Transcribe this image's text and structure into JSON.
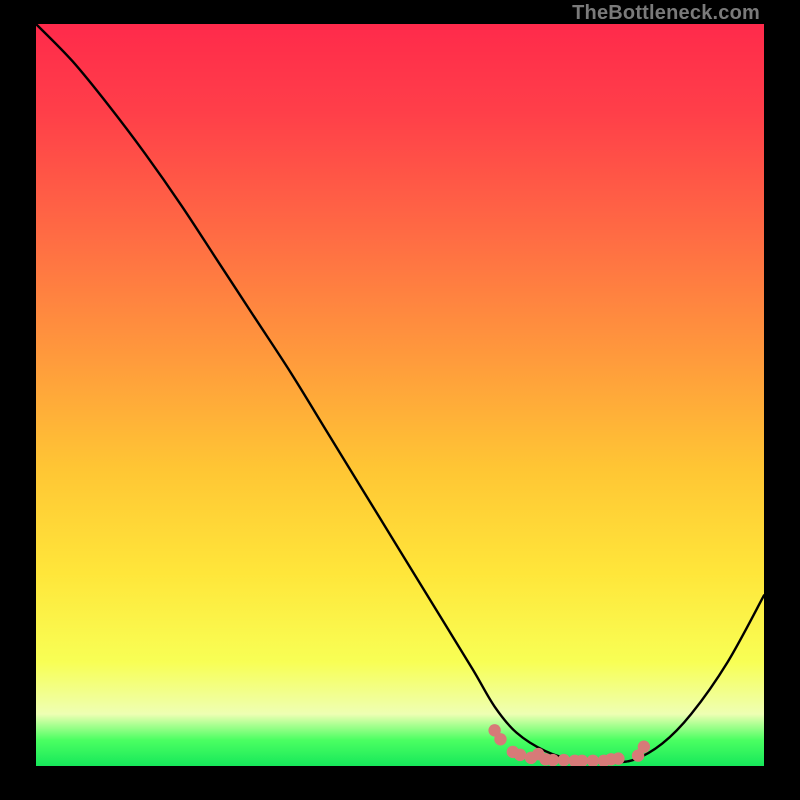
{
  "watermark": "TheBottleneck.com",
  "chart_data": {
    "type": "line",
    "title": "",
    "xlabel": "",
    "ylabel": "",
    "xlim": [
      0,
      100
    ],
    "ylim": [
      0,
      100
    ],
    "grid": false,
    "legend": false,
    "series": [
      {
        "name": "curve",
        "x": [
          0,
          5,
          10,
          15,
          20,
          25,
          30,
          35,
          40,
          45,
          50,
          55,
          60,
          63,
          66,
          70,
          74,
          78,
          82,
          86,
          90,
          95,
          100
        ],
        "y": [
          100,
          95,
          89,
          82.5,
          75.5,
          68,
          60.5,
          53,
          45,
          37,
          29,
          21,
          13,
          8,
          4.5,
          2,
          0.8,
          0.5,
          0.8,
          3,
          7,
          14,
          23
        ]
      }
    ],
    "markers": {
      "name": "bottom-cluster",
      "color": "#d77a78",
      "points": [
        {
          "x": 63.0,
          "y": 4.8
        },
        {
          "x": 63.8,
          "y": 3.6
        },
        {
          "x": 65.5,
          "y": 1.9
        },
        {
          "x": 66.5,
          "y": 1.5
        },
        {
          "x": 68.0,
          "y": 1.1
        },
        {
          "x": 69.0,
          "y": 1.6
        },
        {
          "x": 70.0,
          "y": 0.9
        },
        {
          "x": 71.0,
          "y": 0.8
        },
        {
          "x": 72.5,
          "y": 0.8
        },
        {
          "x": 74.0,
          "y": 0.7
        },
        {
          "x": 75.0,
          "y": 0.7
        },
        {
          "x": 76.5,
          "y": 0.7
        },
        {
          "x": 78.0,
          "y": 0.7
        },
        {
          "x": 79.0,
          "y": 0.9
        },
        {
          "x": 80.0,
          "y": 1.0
        },
        {
          "x": 82.7,
          "y": 1.4
        },
        {
          "x": 83.5,
          "y": 2.6
        }
      ]
    },
    "gradient_stops": [
      {
        "offset": 0.0,
        "color": "#ff2a4b"
      },
      {
        "offset": 0.12,
        "color": "#ff3f49"
      },
      {
        "offset": 0.28,
        "color": "#ff6a44"
      },
      {
        "offset": 0.45,
        "color": "#ff9a3c"
      },
      {
        "offset": 0.6,
        "color": "#ffc634"
      },
      {
        "offset": 0.74,
        "color": "#ffe63a"
      },
      {
        "offset": 0.86,
        "color": "#f8ff55"
      },
      {
        "offset": 0.93,
        "color": "#eeffb3"
      },
      {
        "offset": 0.965,
        "color": "#4bff62"
      },
      {
        "offset": 1.0,
        "color": "#16e85a"
      }
    ]
  }
}
